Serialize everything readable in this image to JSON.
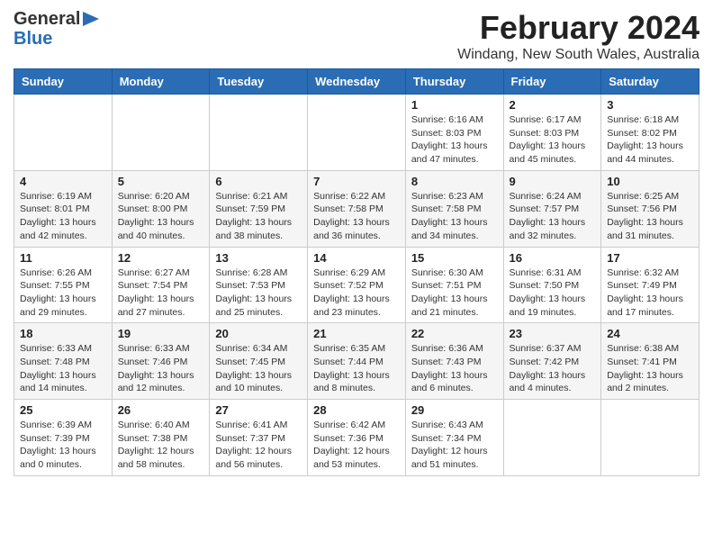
{
  "header": {
    "logo_general": "General",
    "logo_blue": "Blue",
    "title": "February 2024",
    "subtitle": "Windang, New South Wales, Australia"
  },
  "days_of_week": [
    "Sunday",
    "Monday",
    "Tuesday",
    "Wednesday",
    "Thursday",
    "Friday",
    "Saturday"
  ],
  "weeks": [
    [
      {
        "day": "",
        "info": ""
      },
      {
        "day": "",
        "info": ""
      },
      {
        "day": "",
        "info": ""
      },
      {
        "day": "",
        "info": ""
      },
      {
        "day": "1",
        "info": "Sunrise: 6:16 AM\nSunset: 8:03 PM\nDaylight: 13 hours and 47 minutes."
      },
      {
        "day": "2",
        "info": "Sunrise: 6:17 AM\nSunset: 8:03 PM\nDaylight: 13 hours and 45 minutes."
      },
      {
        "day": "3",
        "info": "Sunrise: 6:18 AM\nSunset: 8:02 PM\nDaylight: 13 hours and 44 minutes."
      }
    ],
    [
      {
        "day": "4",
        "info": "Sunrise: 6:19 AM\nSunset: 8:01 PM\nDaylight: 13 hours and 42 minutes."
      },
      {
        "day": "5",
        "info": "Sunrise: 6:20 AM\nSunset: 8:00 PM\nDaylight: 13 hours and 40 minutes."
      },
      {
        "day": "6",
        "info": "Sunrise: 6:21 AM\nSunset: 7:59 PM\nDaylight: 13 hours and 38 minutes."
      },
      {
        "day": "7",
        "info": "Sunrise: 6:22 AM\nSunset: 7:58 PM\nDaylight: 13 hours and 36 minutes."
      },
      {
        "day": "8",
        "info": "Sunrise: 6:23 AM\nSunset: 7:58 PM\nDaylight: 13 hours and 34 minutes."
      },
      {
        "day": "9",
        "info": "Sunrise: 6:24 AM\nSunset: 7:57 PM\nDaylight: 13 hours and 32 minutes."
      },
      {
        "day": "10",
        "info": "Sunrise: 6:25 AM\nSunset: 7:56 PM\nDaylight: 13 hours and 31 minutes."
      }
    ],
    [
      {
        "day": "11",
        "info": "Sunrise: 6:26 AM\nSunset: 7:55 PM\nDaylight: 13 hours and 29 minutes."
      },
      {
        "day": "12",
        "info": "Sunrise: 6:27 AM\nSunset: 7:54 PM\nDaylight: 13 hours and 27 minutes."
      },
      {
        "day": "13",
        "info": "Sunrise: 6:28 AM\nSunset: 7:53 PM\nDaylight: 13 hours and 25 minutes."
      },
      {
        "day": "14",
        "info": "Sunrise: 6:29 AM\nSunset: 7:52 PM\nDaylight: 13 hours and 23 minutes."
      },
      {
        "day": "15",
        "info": "Sunrise: 6:30 AM\nSunset: 7:51 PM\nDaylight: 13 hours and 21 minutes."
      },
      {
        "day": "16",
        "info": "Sunrise: 6:31 AM\nSunset: 7:50 PM\nDaylight: 13 hours and 19 minutes."
      },
      {
        "day": "17",
        "info": "Sunrise: 6:32 AM\nSunset: 7:49 PM\nDaylight: 13 hours and 17 minutes."
      }
    ],
    [
      {
        "day": "18",
        "info": "Sunrise: 6:33 AM\nSunset: 7:48 PM\nDaylight: 13 hours and 14 minutes."
      },
      {
        "day": "19",
        "info": "Sunrise: 6:33 AM\nSunset: 7:46 PM\nDaylight: 13 hours and 12 minutes."
      },
      {
        "day": "20",
        "info": "Sunrise: 6:34 AM\nSunset: 7:45 PM\nDaylight: 13 hours and 10 minutes."
      },
      {
        "day": "21",
        "info": "Sunrise: 6:35 AM\nSunset: 7:44 PM\nDaylight: 13 hours and 8 minutes."
      },
      {
        "day": "22",
        "info": "Sunrise: 6:36 AM\nSunset: 7:43 PM\nDaylight: 13 hours and 6 minutes."
      },
      {
        "day": "23",
        "info": "Sunrise: 6:37 AM\nSunset: 7:42 PM\nDaylight: 13 hours and 4 minutes."
      },
      {
        "day": "24",
        "info": "Sunrise: 6:38 AM\nSunset: 7:41 PM\nDaylight: 13 hours and 2 minutes."
      }
    ],
    [
      {
        "day": "25",
        "info": "Sunrise: 6:39 AM\nSunset: 7:39 PM\nDaylight: 13 hours and 0 minutes."
      },
      {
        "day": "26",
        "info": "Sunrise: 6:40 AM\nSunset: 7:38 PM\nDaylight: 12 hours and 58 minutes."
      },
      {
        "day": "27",
        "info": "Sunrise: 6:41 AM\nSunset: 7:37 PM\nDaylight: 12 hours and 56 minutes."
      },
      {
        "day": "28",
        "info": "Sunrise: 6:42 AM\nSunset: 7:36 PM\nDaylight: 12 hours and 53 minutes."
      },
      {
        "day": "29",
        "info": "Sunrise: 6:43 AM\nSunset: 7:34 PM\nDaylight: 12 hours and 51 minutes."
      },
      {
        "day": "",
        "info": ""
      },
      {
        "day": "",
        "info": ""
      }
    ]
  ]
}
